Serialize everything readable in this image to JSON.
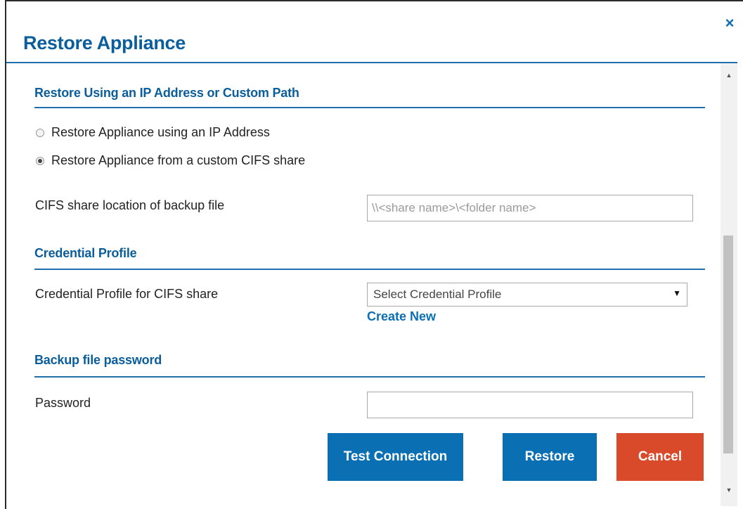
{
  "dialog": {
    "title": "Restore Appliance",
    "close_label": "×"
  },
  "sections": {
    "restore_method": {
      "title": "Restore Using an IP Address or Custom Path",
      "options": [
        {
          "label": "Restore Appliance using an IP Address",
          "checked": false
        },
        {
          "label": "Restore Appliance from a custom CIFS share",
          "checked": true
        }
      ],
      "cifs_label": "CIFS share location of backup file",
      "cifs_placeholder": "\\\\<share name>\\<folder name>",
      "cifs_value": ""
    },
    "credential": {
      "title": "Credential Profile",
      "label": "Credential Profile for CIFS share",
      "select_value": "Select Credential Profile",
      "create_new": "Create New"
    },
    "backup_password": {
      "title": "Backup file password",
      "label": "Password",
      "value": ""
    }
  },
  "buttons": {
    "test_connection": "Test Connection",
    "restore": "Restore",
    "cancel": "Cancel"
  },
  "colors": {
    "accent": "#0b6fb3",
    "danger": "#d94a2b"
  }
}
